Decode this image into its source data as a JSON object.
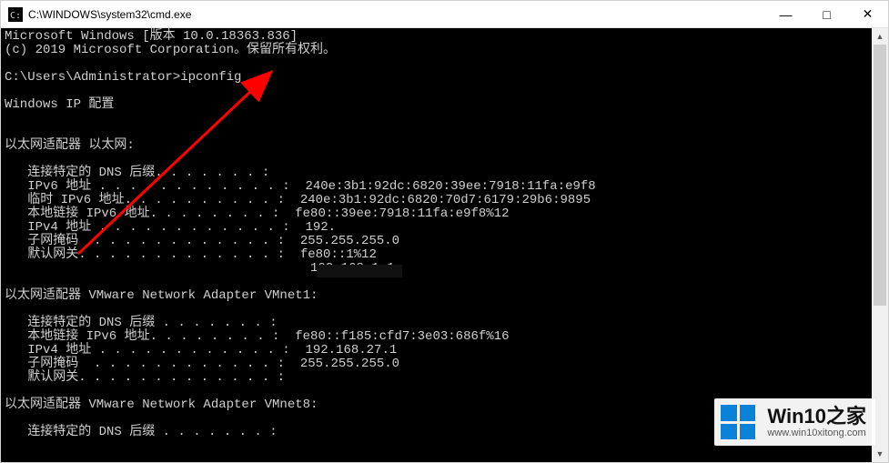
{
  "window": {
    "title": "C:\\WINDOWS\\system32\\cmd.exe",
    "controls": {
      "minimize": "—",
      "maximize": "□",
      "close": "✕"
    }
  },
  "terminal": {
    "banner_line1": "Microsoft Windows [版本 10.0.18363.836]",
    "banner_line2": "(c) 2019 Microsoft Corporation。保留所有权利。",
    "prompt": "C:\\Users\\Administrator>",
    "command": "ipconfig",
    "section_header": "Windows IP 配置",
    "adapter1": {
      "title": "以太网适配器 以太网:",
      "lines": [
        {
          "label": "连接特定的 DNS 后缀",
          "dots": ". . . . . . . :",
          "value": ""
        },
        {
          "label": "IPv6 地址",
          "dots": " . . . . . . . . . . . . :",
          "value": "240e:3b1:92dc:6820:39ee:7918:11fa:e9f8"
        },
        {
          "label": "临时 IPv6 地址",
          "dots": ". . . . . . . . . . :",
          "value": "240e:3b1:92dc:6820:70d7:6179:29b6:9895"
        },
        {
          "label": "本地链接 IPv6 地址",
          "dots": ". . . . . . . . :",
          "value": "fe80::39ee:7918:11fa:e9f8%12"
        },
        {
          "label": "IPv4 地址",
          "dots": " . . . . . . . . . . . . :",
          "value": "192."
        },
        {
          "label": "子网掩码",
          "dots": "  . . . . . . . . . . . . :",
          "value": "255.255.255.0"
        },
        {
          "label": "默认网关",
          "dots": ". . . . . . . . . . . . . :",
          "value": "fe80::1%12"
        },
        {
          "label": "",
          "dots": "                               ",
          "value": "192.168.1.1"
        }
      ]
    },
    "adapter2": {
      "title": "以太网适配器 VMware Network Adapter VMnet1:",
      "lines": [
        {
          "label": "连接特定的 DNS 后缀",
          "dots": " . . . . . . . :",
          "value": ""
        },
        {
          "label": "本地链接 IPv6 地址",
          "dots": ". . . . . . . . :",
          "value": "fe80::f185:cfd7:3e03:686f%16"
        },
        {
          "label": "IPv4 地址",
          "dots": " . . . . . . . . . . . . :",
          "value": "192.168.27.1"
        },
        {
          "label": "子网掩码",
          "dots": "  . . . . . . . . . . . . :",
          "value": "255.255.255.0"
        },
        {
          "label": "默认网关",
          "dots": ". . . . . . . . . . . . . :",
          "value": ""
        }
      ]
    },
    "adapter3": {
      "title": "以太网适配器 VMware Network Adapter VMnet8:",
      "lines": [
        {
          "label": "连接特定的 DNS 后缀",
          "dots": " . . . . . . . :",
          "value": ""
        }
      ]
    }
  },
  "watermark": {
    "brand": "Win10之家",
    "url": "www.win10xitong.com"
  }
}
